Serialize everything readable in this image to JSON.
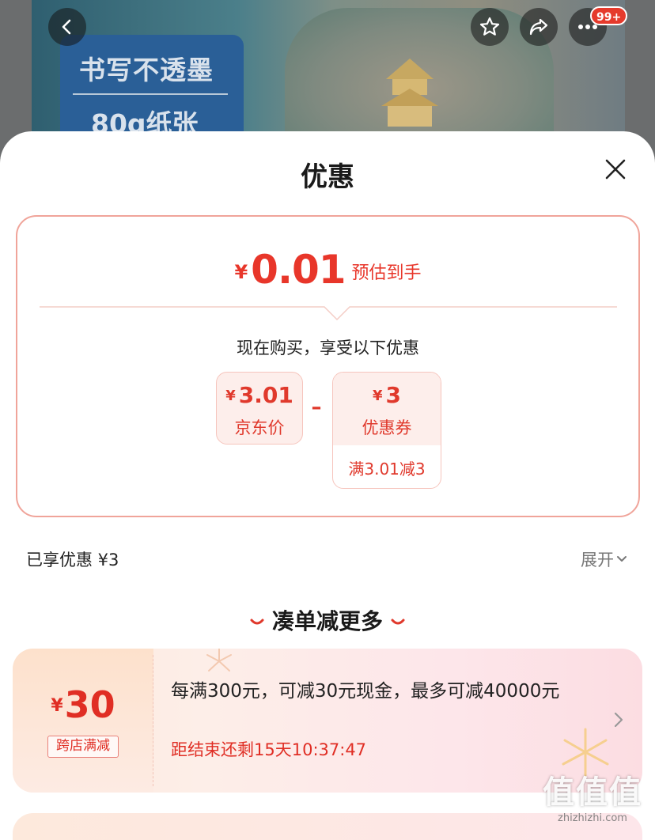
{
  "hero": {
    "promo_line1": "书写不透墨",
    "promo_line2": "80g纸张",
    "cart_badge": "99+"
  },
  "icons": {
    "back": "chevron-left-icon",
    "favorite": "star-icon",
    "share": "share-icon",
    "more": "more-icon",
    "close": "close-icon",
    "expand": "chevron-down-icon",
    "promo_arrow": "chevron-right-icon"
  },
  "sheet": {
    "title": "优惠",
    "final_price": {
      "currency": "¥",
      "amount": "0.01",
      "note": "预估到手"
    },
    "enjoy_text": "现在购买，享受以下优惠",
    "breakdown": {
      "jd_price": {
        "currency": "¥",
        "value": "3.01",
        "label": "京东价"
      },
      "operator": "–",
      "coupon": {
        "currency": "¥",
        "value": "3",
        "label": "优惠券",
        "condition": "满3.01减3"
      }
    },
    "enjoyed_label": "已享优惠 ¥3",
    "expand_label": "展开",
    "more_title": "凑单减更多",
    "promotions": [
      {
        "currency": "¥",
        "amount": "30",
        "tag": "跨店满减",
        "description": "每满300元，可减30元现金，最多可减40000元",
        "countdown": "距结束还剩15天10:37:47"
      }
    ]
  },
  "watermark": {
    "chars": "值值值",
    "url": "zhizhizhi.com"
  },
  "colors": {
    "accent": "#e8362a",
    "card_border": "#f0a49a",
    "chip_bg": "#fdeeeb"
  }
}
